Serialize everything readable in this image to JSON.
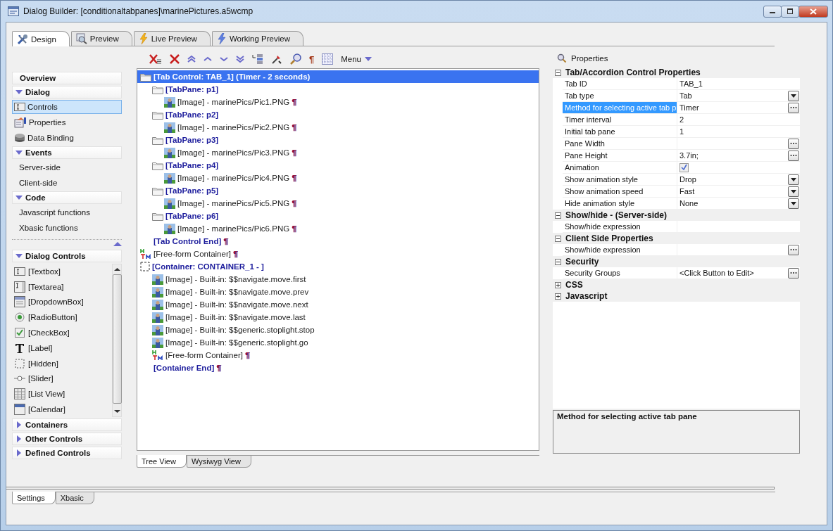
{
  "window": {
    "title": "Dialog Builder: [conditionaltabpanes]\\marinePictures.a5wcmp"
  },
  "tabs": [
    {
      "label": "Design",
      "kind": "design",
      "selected": true
    },
    {
      "label": "Preview",
      "kind": "preview",
      "selected": false
    },
    {
      "label": "Live Preview",
      "kind": "live",
      "selected": false
    },
    {
      "label": "Working Preview",
      "kind": "working",
      "selected": false
    }
  ],
  "sidebar": {
    "sections": [
      {
        "title": "Overview",
        "kind": "link"
      },
      {
        "title": "Dialog",
        "kind": "group",
        "expanded": true,
        "items": [
          {
            "label": "Controls",
            "kind": "controls",
            "selected": true
          },
          {
            "label": "Properties",
            "kind": "properties",
            "selected": false
          },
          {
            "label": "Data Binding",
            "kind": "binding",
            "selected": false
          }
        ]
      },
      {
        "title": "Events",
        "kind": "group",
        "expanded": true,
        "items": [
          {
            "label": "Server-side",
            "kind": "plain",
            "selected": false
          },
          {
            "label": "Client-side",
            "kind": "plain",
            "selected": false
          }
        ]
      },
      {
        "title": "Code",
        "kind": "group",
        "expanded": true,
        "items": [
          {
            "label": "Javascript functions",
            "kind": "plain",
            "selected": false
          },
          {
            "label": "Xbasic functions",
            "kind": "plain",
            "selected": false
          }
        ]
      }
    ],
    "palette": {
      "title": "Dialog Controls",
      "expanded": true,
      "items": [
        {
          "label": "[Textbox]",
          "kind": "textbox"
        },
        {
          "label": "[Textarea]",
          "kind": "textarea"
        },
        {
          "label": "[DropdownBox]",
          "kind": "dropdown"
        },
        {
          "label": "[RadioButton]",
          "kind": "radio"
        },
        {
          "label": "[CheckBox]",
          "kind": "checkbox"
        },
        {
          "label": "[Label]",
          "kind": "label"
        },
        {
          "label": "[Hidden]",
          "kind": "hidden"
        },
        {
          "label": "[Slider]",
          "kind": "slider"
        },
        {
          "label": "[List View]",
          "kind": "listview"
        },
        {
          "label": "[Calendar]",
          "kind": "calendar"
        }
      ]
    },
    "more_sections": [
      {
        "title": "Containers",
        "expanded": false
      },
      {
        "title": "Other Controls",
        "expanded": false
      },
      {
        "title": "Defined Controls",
        "expanded": false
      }
    ]
  },
  "toolbar": {
    "pilcrow": "¶",
    "menu": "Menu"
  },
  "tree": [
    {
      "text": "[Tab Control: TAB_1] (Timer - 2 seconds)",
      "kind": "folder",
      "selected": true,
      "children": [
        {
          "text": "[TabPane: p1]",
          "kind": "folder",
          "selected": false,
          "children": [
            {
              "text": "[Image] - marinePics/Pic1.PNG",
              "kind": "image",
              "pilcrow": "¶",
              "selected": false
            }
          ]
        },
        {
          "text": "[TabPane: p2]",
          "kind": "folder",
          "selected": false,
          "children": [
            {
              "text": "[Image] - marinePics/Pic2.PNG",
              "kind": "image",
              "pilcrow": "¶",
              "selected": false
            }
          ]
        },
        {
          "text": "[TabPane: p3]",
          "kind": "folder",
          "selected": false,
          "children": [
            {
              "text": "[Image] - marinePics/Pic3.PNG",
              "kind": "image",
              "pilcrow": "¶",
              "selected": false
            }
          ]
        },
        {
          "text": "[TabPane: p4]",
          "kind": "folder",
          "selected": false,
          "children": [
            {
              "text": "[Image] - marinePics/Pic4.PNG",
              "kind": "image",
              "pilcrow": "¶",
              "selected": false
            }
          ]
        },
        {
          "text": "[TabPane: p5]",
          "kind": "folder",
          "selected": false,
          "children": [
            {
              "text": "[Image] - marinePics/Pic5.PNG",
              "kind": "image",
              "pilcrow": "¶",
              "selected": false
            }
          ]
        },
        {
          "text": "[TabPane: p6]",
          "kind": "folder",
          "selected": false,
          "children": [
            {
              "text": "[Image] - marinePics/Pic6.PNG",
              "kind": "image",
              "pilcrow": "¶",
              "selected": false
            }
          ]
        },
        {
          "text": "[Tab Control End]",
          "kind": "end",
          "pilcrow": "¶",
          "selected": false
        }
      ]
    },
    {
      "text": "[Free-form Container]",
      "kind": "freeform",
      "pilcrow": "¶",
      "selected": false
    },
    {
      "text": "[Container: CONTAINER_1 - ]",
      "kind": "container",
      "selected": false,
      "children": [
        {
          "text": "[Image] - Built-in: $$navigate.move.first",
          "kind": "image",
          "selected": false
        },
        {
          "text": "[Image] - Built-in: $$navigate.move.prev",
          "kind": "image",
          "selected": false
        },
        {
          "text": "[Image] - Built-in: $$navigate.move.next",
          "kind": "image",
          "selected": false
        },
        {
          "text": "[Image] - Built-in: $$navigate.move.last",
          "kind": "image",
          "selected": false
        },
        {
          "text": "[Image] - Built-in: $$generic.stoplight.stop",
          "kind": "image",
          "selected": false
        },
        {
          "text": "[Image] - Built-in: $$generic.stoplight.go",
          "kind": "image",
          "selected": false
        },
        {
          "text": "[Free-form Container]",
          "kind": "freeform",
          "pilcrow": "¶",
          "selected": false
        },
        {
          "text": "[Container End]",
          "kind": "end",
          "pilcrow": "¶",
          "selected": false
        }
      ]
    }
  ],
  "view_tabs": [
    {
      "label": "Tree View",
      "selected": true
    },
    {
      "label": "Wysiwyg View",
      "selected": false
    }
  ],
  "properties": {
    "title": "Properties",
    "groups": [
      {
        "title": "Tab/Accordion Control Properties",
        "expanded": true,
        "rows": [
          {
            "label": "Tab ID",
            "value": "TAB_1",
            "kind": "text",
            "selected": false
          },
          {
            "label": "Tab type",
            "value": "Tab",
            "kind": "dropdown",
            "selected": false
          },
          {
            "label": "Method for selecting active tab p",
            "value": "Timer",
            "kind": "ellipsis",
            "selected": true
          },
          {
            "label": "Timer interval",
            "value": "2",
            "kind": "text",
            "selected": false
          },
          {
            "label": "Initial tab pane",
            "value": "1",
            "kind": "text",
            "selected": false
          },
          {
            "label": "Pane Width",
            "kind": "ellipsis",
            "selected": false
          },
          {
            "label": "Pane Height",
            "value": "3.7in;",
            "kind": "ellipsis",
            "selected": false
          },
          {
            "label": "Animation",
            "kind": "checkbox",
            "checked": true,
            "selected": false
          },
          {
            "label": "Show animation style",
            "value": "Drop",
            "kind": "dropdown",
            "selected": false
          },
          {
            "label": "Show animation speed",
            "value": "Fast",
            "kind": "dropdown",
            "selected": false
          },
          {
            "label": "Hide animation style",
            "value": "None",
            "kind": "dropdown",
            "selected": false
          }
        ]
      },
      {
        "title": "Show/hide - (Server-side)",
        "expanded": true,
        "rows": [
          {
            "label": "Show/hide expression",
            "kind": "text",
            "selected": false
          }
        ]
      },
      {
        "title": "Client Side Properties",
        "expanded": true,
        "rows": [
          {
            "label": "Show/hide expression",
            "kind": "ellipsis",
            "selected": false
          }
        ]
      },
      {
        "title": "Security",
        "expanded": true,
        "rows": [
          {
            "label": "Security Groups",
            "value": "<Click Button to Edit>",
            "kind": "ellipsis",
            "selected": false
          }
        ]
      },
      {
        "title": "CSS",
        "expanded": false
      },
      {
        "title": "Javascript",
        "expanded": false
      }
    ],
    "description": "Method for selecting active tab pane"
  },
  "bottom_tabs": [
    {
      "label": "Settings",
      "selected": true
    },
    {
      "label": "Xbasic",
      "selected": false
    }
  ]
}
